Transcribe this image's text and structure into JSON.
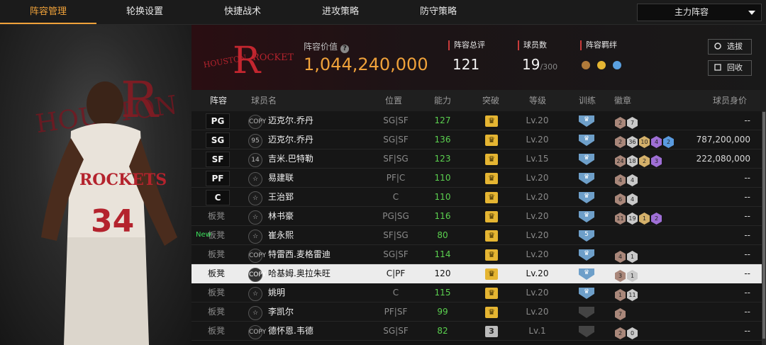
{
  "nav": {
    "tabs": [
      "阵容管理",
      "轮换设置",
      "快捷战术",
      "进攻策略",
      "防守策略"
    ],
    "active_index": 0,
    "lineup_select": "主力阵容"
  },
  "hero": {
    "new_label": "New"
  },
  "info": {
    "value_label": "阵容价值",
    "value": "1,044,240,000",
    "rating_label": "阵容总评",
    "rating": "121",
    "count_label": "球员数",
    "count": "19",
    "count_max": "/300",
    "bond_label": "阵容羁绊",
    "btn_scout": "选拔",
    "btn_recycle": "回收"
  },
  "table": {
    "headers": [
      "阵容",
      "球员名",
      "位置",
      "能力",
      "突破",
      "等级",
      "训练",
      "徽章",
      "球员身价"
    ],
    "rows": [
      {
        "slot": "PG",
        "boxed": true,
        "num": "COPY",
        "name": "迈克尔.乔丹",
        "pos": "SG|SF",
        "ability": "127",
        "break": "♛",
        "level": "Lv.20",
        "train": "♛",
        "badges": [
          "2",
          "7"
        ],
        "worth": "--"
      },
      {
        "slot": "SG",
        "boxed": true,
        "num": "95",
        "name": "迈克尔.乔丹",
        "pos": "SG|SF",
        "ability": "136",
        "break": "♛",
        "level": "Lv.20",
        "train": "♛",
        "badges": [
          "2",
          "36",
          "10",
          "4",
          "2"
        ],
        "worth": "787,200,000"
      },
      {
        "slot": "SF",
        "boxed": true,
        "num": "14",
        "name": "吉米.巴特勒",
        "pos": "SF|SG",
        "ability": "123",
        "break": "♛",
        "level": "Lv.15",
        "train": "♛",
        "badges": [
          "24",
          "18",
          "2",
          "3"
        ],
        "worth": "222,080,000"
      },
      {
        "slot": "PF",
        "boxed": true,
        "num": "☆",
        "name": "易建联",
        "pos": "PF|C",
        "ability": "110",
        "break": "♛",
        "level": "Lv.20",
        "train": "♛",
        "badges": [
          "4",
          "4"
        ],
        "worth": "--"
      },
      {
        "slot": "C",
        "boxed": true,
        "num": "☆",
        "name": "王治郅",
        "pos": "C",
        "ability": "110",
        "break": "♛",
        "level": "Lv.20",
        "train": "♛",
        "badges": [
          "6",
          "4"
        ],
        "worth": "--"
      },
      {
        "slot": "板凳",
        "boxed": false,
        "num": "☆",
        "name": "林书豪",
        "pos": "PG|SG",
        "ability": "116",
        "break": "♛",
        "level": "Lv.20",
        "train": "♛",
        "badges": [
          "11",
          "19",
          "1",
          "2"
        ],
        "worth": "--"
      },
      {
        "slot": "板凳",
        "boxed": false,
        "num": "☆",
        "name": "崔永熙",
        "pos": "SF|SG",
        "ability": "80",
        "break": "♛",
        "level": "Lv.20",
        "train": "5",
        "badges": [],
        "worth": "--"
      },
      {
        "slot": "板凳",
        "boxed": false,
        "num": "COPY",
        "name": "特雷西.麦格雷迪",
        "pos": "SG|SF",
        "ability": "114",
        "break": "♛",
        "level": "Lv.20",
        "train": "♛",
        "badges": [
          "4",
          "1"
        ],
        "worth": "--"
      },
      {
        "slot": "板凳",
        "boxed": false,
        "num": "COPY",
        "name": "哈基姆.奥拉朱旺",
        "pos": "C|PF",
        "ability": "120",
        "break": "♛",
        "level": "Lv.20",
        "train": "♛",
        "badges": [
          "3",
          "1"
        ],
        "worth": "--",
        "selected": true
      },
      {
        "slot": "板凳",
        "boxed": false,
        "num": "☆",
        "name": "姚明",
        "pos": "C",
        "ability": "115",
        "break": "♛",
        "level": "Lv.20",
        "train": "♛",
        "badges": [
          "1",
          "11"
        ],
        "worth": "--"
      },
      {
        "slot": "板凳",
        "boxed": false,
        "num": "☆",
        "name": "李凯尔",
        "pos": "PF|SF",
        "ability": "99",
        "break": "♛",
        "level": "Lv.20",
        "train": "",
        "badges": [
          "7"
        ],
        "worth": "--"
      },
      {
        "slot": "板凳",
        "boxed": false,
        "num": "COPY",
        "name": "德怀恩.韦德",
        "pos": "SG|SF",
        "ability": "82",
        "break": "3",
        "level": "Lv.1",
        "train": "",
        "badges": [
          "2",
          "0"
        ],
        "worth": "--"
      }
    ]
  },
  "colors": {
    "accent": "#f0a23a",
    "ability": "#5bd14f",
    "crown": "#e5b532",
    "train": "#6e9fc9"
  }
}
